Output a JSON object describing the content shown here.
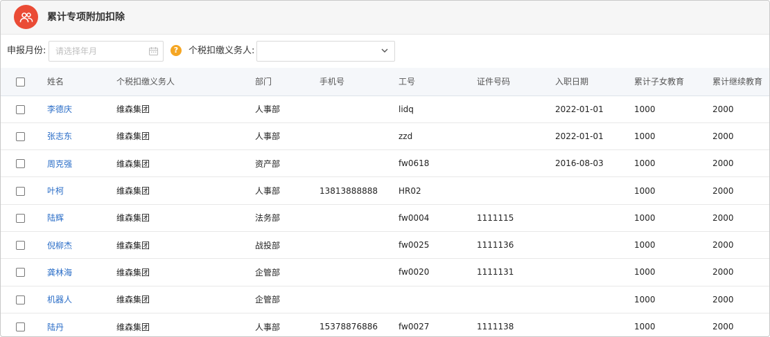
{
  "header": {
    "title": "累计专项附加扣除",
    "logo_icon": "users-icon",
    "logo_color": "#ea4b35"
  },
  "filter": {
    "month_label": "申报月份:",
    "month_placeholder": "请选择年月",
    "month_value": "",
    "agent_label": "个税扣缴义务人:",
    "agent_value": "",
    "help_icon": "?"
  },
  "table": {
    "headers": [
      "姓名",
      "个税扣缴义务人",
      "部门",
      "手机号",
      "工号",
      "证件号码",
      "入职日期",
      "累计子女教育",
      "累计继续教育"
    ],
    "rows": [
      {
        "name": "李德庆",
        "agent": "维森集团",
        "dept": "人事部",
        "phone": "",
        "job_no": "lidq",
        "id_no": "",
        "hire_date": "2022-01-01",
        "child_edu": "1000",
        "cont_edu": "2000"
      },
      {
        "name": "张志东",
        "agent": "维森集团",
        "dept": "人事部",
        "phone": "",
        "job_no": "zzd",
        "id_no": "",
        "hire_date": "2022-01-01",
        "child_edu": "1000",
        "cont_edu": "2000"
      },
      {
        "name": "周克强",
        "agent": "维森集团",
        "dept": "资产部",
        "phone": "",
        "job_no": "fw0618",
        "id_no": "",
        "hire_date": "2016-08-03",
        "child_edu": "1000",
        "cont_edu": "2000"
      },
      {
        "name": "叶柯",
        "agent": "维森集团",
        "dept": "人事部",
        "phone": "13813888888",
        "job_no": "HR02",
        "id_no": "",
        "hire_date": "",
        "child_edu": "1000",
        "cont_edu": "2000"
      },
      {
        "name": "陆辉",
        "agent": "维森集团",
        "dept": "法务部",
        "phone": "",
        "job_no": "fw0004",
        "id_no": "1111115",
        "hire_date": "",
        "child_edu": "1000",
        "cont_edu": "2000"
      },
      {
        "name": "倪柳杰",
        "agent": "维森集团",
        "dept": "战投部",
        "phone": "",
        "job_no": "fw0025",
        "id_no": "1111136",
        "hire_date": "",
        "child_edu": "1000",
        "cont_edu": "2000"
      },
      {
        "name": "龚林海",
        "agent": "维森集团",
        "dept": "企管部",
        "phone": "",
        "job_no": "fw0020",
        "id_no": "1111131",
        "hire_date": "",
        "child_edu": "1000",
        "cont_edu": "2000"
      },
      {
        "name": "机器人",
        "agent": "维森集团",
        "dept": "企管部",
        "phone": "",
        "job_no": "",
        "id_no": "",
        "hire_date": "",
        "child_edu": "1000",
        "cont_edu": "2000"
      },
      {
        "name": "陆丹",
        "agent": "维森集团",
        "dept": "人事部",
        "phone": "15378876886",
        "job_no": "fw0027",
        "id_no": "1111138",
        "hire_date": "",
        "child_edu": "1000",
        "cont_edu": "2000"
      }
    ]
  }
}
